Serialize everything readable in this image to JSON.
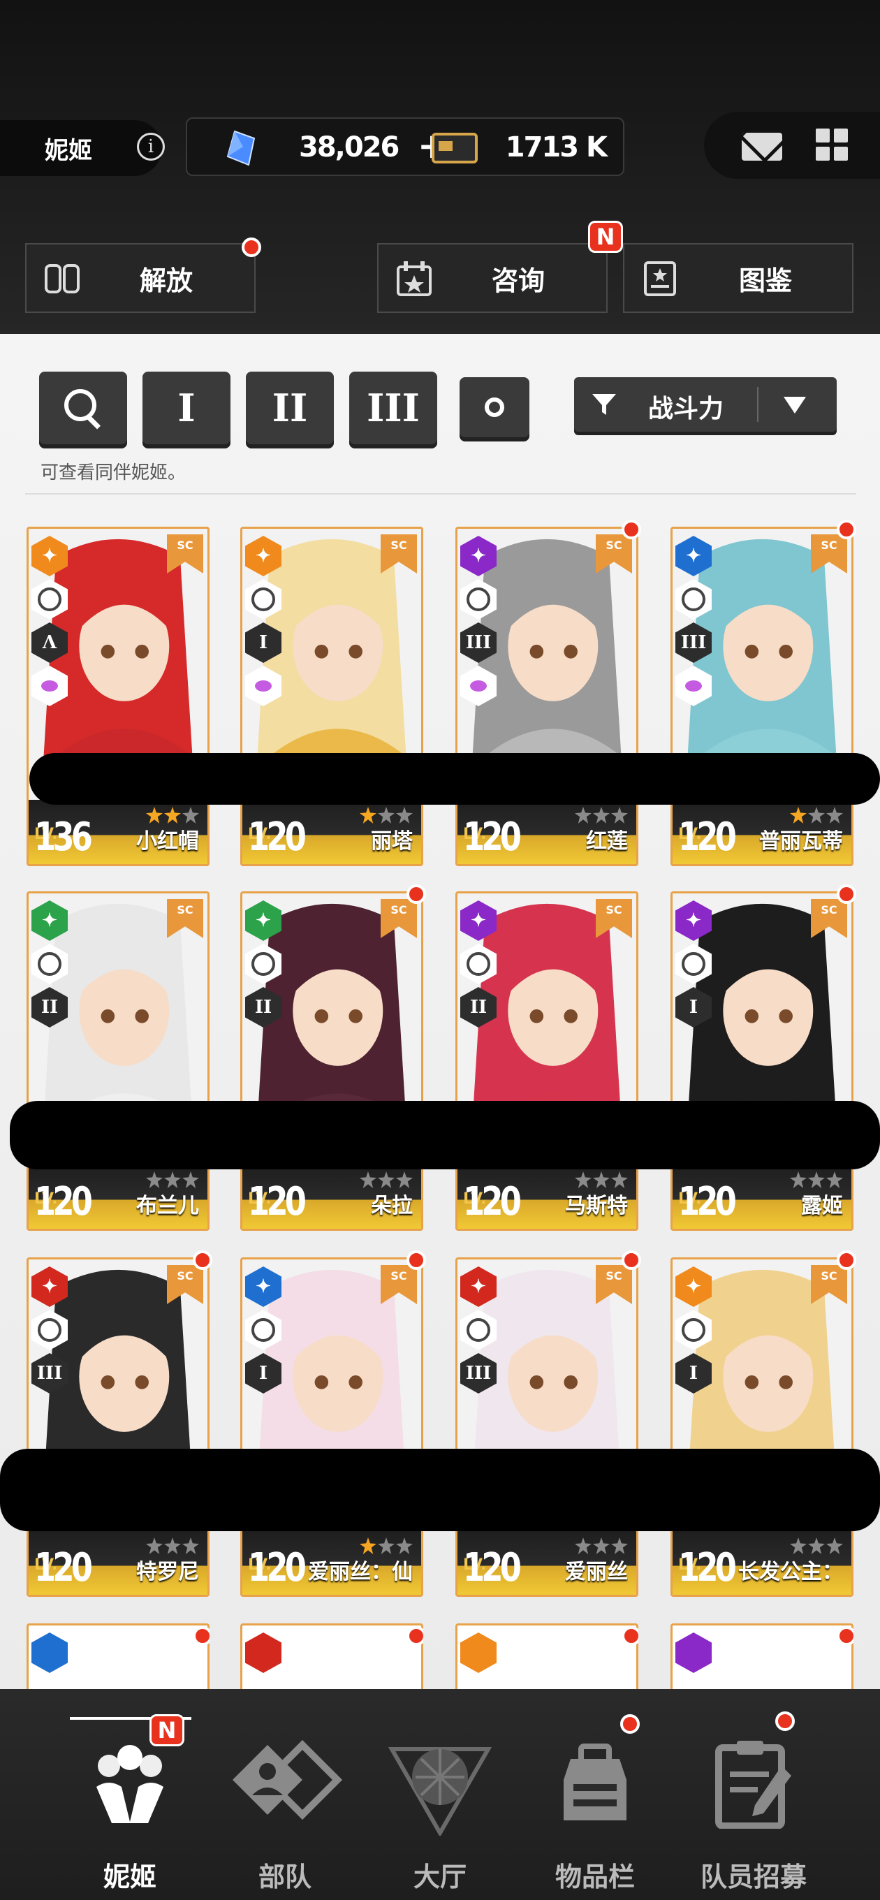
{
  "header": {
    "character_label": "妮姬",
    "gem_value": "38,026",
    "plus_label": "+",
    "credit_value": "1713 K",
    "menu": [
      {
        "label": "解放",
        "badge": "dot"
      },
      {
        "label": "咨询",
        "badge": "N"
      },
      {
        "label": "图鉴",
        "badge": ""
      }
    ]
  },
  "filters": {
    "search": "search",
    "burst_1": "I",
    "burst_2": "II",
    "burst_3": "III",
    "sort_label": "战斗力",
    "hint": "可查看同伴妮姬。"
  },
  "characters": [
    {
      "name": "小红帽",
      "level": "136",
      "lv_label": "LV.",
      "element_color": "#f08a1c",
      "burst": "Λ",
      "stars": 2,
      "dot": false,
      "accent": "#c8282c",
      "hair": "#d62a2a"
    },
    {
      "name": "丽塔",
      "level": "120",
      "lv_label": "LV.",
      "element_color": "#f08a1c",
      "burst": "I",
      "stars": 1,
      "dot": false,
      "accent": "#e8b33a",
      "hair": "#f3dda0"
    },
    {
      "name": "红莲",
      "level": "120",
      "lv_label": "LV.",
      "element_color": "#8a28c8",
      "burst": "III",
      "stars": 0,
      "dot": true,
      "accent": "#bdbdbd",
      "hair": "#9a9a9a"
    },
    {
      "name": "普丽瓦蒂",
      "level": "120",
      "lv_label": "LV.",
      "element_color": "#1f6fd0",
      "burst": "III",
      "stars": 1,
      "dot": true,
      "accent": "#8ed0d8",
      "hair": "#7fc6d0"
    },
    {
      "name": "布兰儿",
      "level": "120",
      "lv_label": "LV.",
      "element_color": "#2ca34a",
      "burst": "II",
      "stars": 0,
      "dot": false,
      "accent": "#f0f0f0",
      "hair": "#e8e8e8"
    },
    {
      "name": "朵拉",
      "level": "120",
      "lv_label": "LV.",
      "element_color": "#2ca34a",
      "burst": "II",
      "stars": 0,
      "dot": true,
      "accent": "#5a2a3a",
      "hair": "#4e2230"
    },
    {
      "name": "马斯特",
      "level": "120",
      "lv_label": "LV.",
      "element_color": "#8a28c8",
      "burst": "II",
      "stars": 0,
      "dot": false,
      "accent": "#d6344e",
      "hair": "#d6344e"
    },
    {
      "name": "露姬",
      "level": "120",
      "lv_label": "LV.",
      "element_color": "#8a28c8",
      "burst": "I",
      "stars": 0,
      "dot": true,
      "accent": "#1d1d1d",
      "hair": "#1d1d1d"
    },
    {
      "name": "特罗尼",
      "level": "120",
      "lv_label": "LV.",
      "element_color": "#d2281e",
      "burst": "III",
      "stars": 0,
      "dot": true,
      "accent": "#2a2a2a",
      "hair": "#2a2a2a"
    },
    {
      "name": "爱丽丝：仙",
      "level": "120",
      "lv_label": "LV.",
      "element_color": "#1f6fd0",
      "burst": "I",
      "stars": 1,
      "dot": true,
      "accent": "#f4c9d8",
      "hair": "#f4dde6"
    },
    {
      "name": "爱丽丝",
      "level": "120",
      "lv_label": "LV.",
      "element_color": "#d2281e",
      "burst": "III",
      "stars": 0,
      "dot": true,
      "accent": "#f09ab8",
      "hair": "#f0e6ee"
    },
    {
      "name": "长发公主：",
      "level": "120",
      "lv_label": "LV.",
      "element_color": "#f08a1c",
      "burst": "I",
      "stars": 0,
      "dot": true,
      "accent": "#e9c98a",
      "hair": "#f0d28e"
    }
  ],
  "bottom_nav": [
    {
      "label": "妮姬",
      "icon": "nikke-icon",
      "active": true,
      "badge": "N"
    },
    {
      "label": "部队",
      "icon": "squad-icon",
      "active": false,
      "badge": ""
    },
    {
      "label": "大厅",
      "icon": "lobby-icon",
      "active": false,
      "badge": ""
    },
    {
      "label": "物品栏",
      "icon": "inventory-icon",
      "active": false,
      "badge": "dot"
    },
    {
      "label": "队员招募",
      "icon": "recruit-icon",
      "active": false,
      "badge": "dot"
    }
  ]
}
